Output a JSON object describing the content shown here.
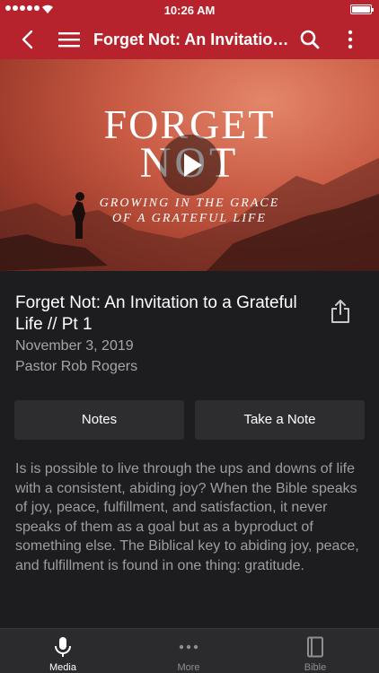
{
  "status_bar": {
    "time": "10:26 AM"
  },
  "nav": {
    "title": "Forget Not: An Invitation..."
  },
  "hero": {
    "line1": "FORGET",
    "line2": "NOT",
    "subtitle_line1": "GROWING IN THE GRACE",
    "subtitle_line2": "OF A GRATEFUL LIFE"
  },
  "media": {
    "title": "Forget Not: An Invitation to a Grateful Life // Pt 1",
    "date": "November 3, 2019",
    "speaker": "Pastor Rob Rogers",
    "description": "Is is possible to live through the ups and downs of life with a consistent, abiding joy? When the Bible speaks of joy, peace, fulfillment, and satisfaction, it never speaks of them as a goal but as a byproduct of something else. The Biblical key to abiding joy, peace, and fulfillment is found in one thing: gratitude."
  },
  "buttons": {
    "notes": "Notes",
    "take_note": "Take a Note"
  },
  "tabs": [
    {
      "label": "Media",
      "icon": "microphone-icon",
      "active": true
    },
    {
      "label": "More",
      "icon": "ellipsis-icon",
      "active": false
    },
    {
      "label": "Bible",
      "icon": "book-icon",
      "active": false
    }
  ],
  "colors": {
    "accent": "#b7232c",
    "background": "#1d1d1f",
    "button": "#2d2d30",
    "tabbar": "#2b2b2e"
  }
}
